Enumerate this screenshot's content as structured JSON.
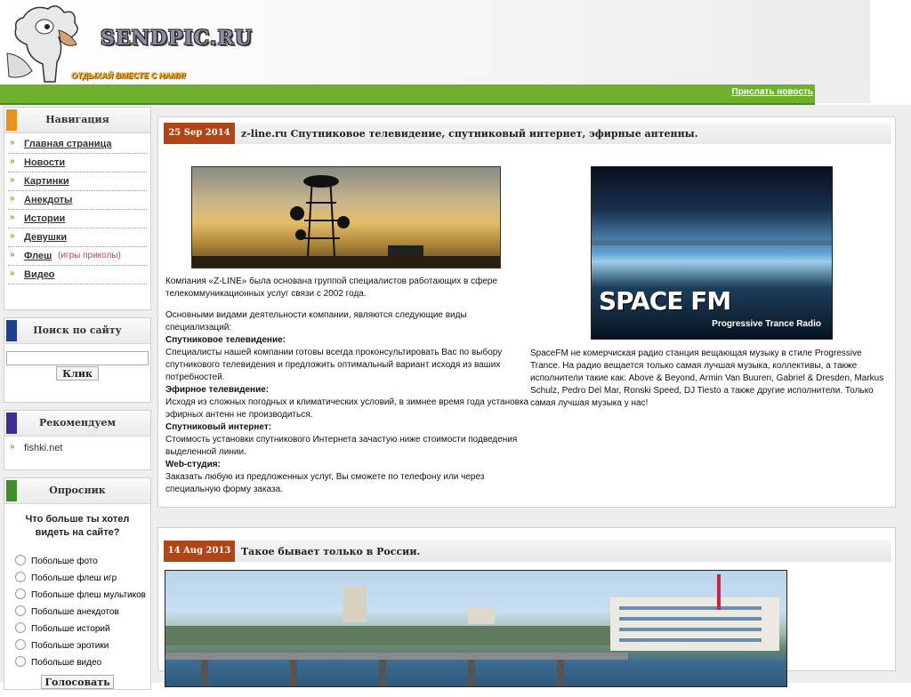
{
  "site": {
    "logo_text": "SENDPIC.RU",
    "slogan": "ОТДЫХАЙ ВМЕСТЕ С НАМИ!",
    "submit_news": "Прислать новость"
  },
  "sidebar": {
    "navigation": {
      "title": "Навигация",
      "items": [
        {
          "label": "Главная страница",
          "note": ""
        },
        {
          "label": "Новости",
          "note": ""
        },
        {
          "label": "Картинки",
          "note": ""
        },
        {
          "label": "Анекдоты",
          "note": ""
        },
        {
          "label": "Истории",
          "note": ""
        },
        {
          "label": "Девушки",
          "note": ""
        },
        {
          "label": "Флеш",
          "note": "(игры приколы)"
        },
        {
          "label": "Видео",
          "note": ""
        }
      ]
    },
    "search": {
      "title": "Поиск по сайту",
      "value": "",
      "button": "Клик"
    },
    "recommend": {
      "title": "Рекомендуем",
      "items": [
        "fishki.net"
      ]
    },
    "poll": {
      "title": "Опросник",
      "question": "Что больше ты хотел видеть на сайте?",
      "options": [
        "Побольше фото",
        "Побольше флеш игр",
        "Побольше флеш мультиков",
        "Побольше анекдотов",
        "Побольше историй",
        "Побольше эротики",
        "Побольше видео"
      ],
      "button": "Голосовать"
    },
    "colors": {
      "nav_stripe": "#e8911c",
      "search_stripe": "#1f3f8f",
      "recommend_stripe": "#3a2f91",
      "poll_stripe": "#3e8f2a"
    }
  },
  "posts": [
    {
      "date": "25 Sep 2014",
      "title": "z-line.ru Спутниковое телевидение, спутниковый интернет, эфирные антенны.",
      "left": {
        "intro": "Компания «Z-LINE» была основана группой специалистов работающих в сфере телекоммуникационных услуг связи с 2002 года.",
        "types_intro": "Основными видами деятельности компании, являются следующие виды специализаций:",
        "sections": [
          {
            "heading": "Спутниковое телевидение:",
            "text": "Специалисты нашей компании готовы всегда проконсультировать Вас по выбору спутникового телевидения и предложить оптимальный вариант исходя из ваших потребностей."
          },
          {
            "heading": "Эфирное телевидение:",
            "text": "Исходя из сложных погодных и климатических условий, в зимнее время года установка эфирных антенн не производиться."
          },
          {
            "heading": "Спутниковый интернет:",
            "text": "Стоимость установки спутникового Интернета зачастую ниже стоимости подведения выделенной линии."
          },
          {
            "heading": "Web-студия:",
            "text": "Заказать любую из предложенных услуг, Вы сможете по телефону или через специальную форму заказа."
          }
        ]
      },
      "right": {
        "image_title": "SPACE FM",
        "image_subtitle": "Progressive Trance Radio",
        "text": "SpaceFM не комерчиская радио станция вещающая музыку в стиле Progressive Trance. На радио вещается только самая лучшая музыка, коллективы, а также исполнители такие как: Above & Beyond, Armin Van Buuren, Gabriel & Dresden, Markus Schulz, Pedro Del Mar, Ronski Speed, DJ Tiesto а также другие исполнители. Только самая лучшая музыка у нас!"
      }
    },
    {
      "date": "14 Aug 2013",
      "title": "Такое бывает только в России."
    }
  ],
  "colors": {
    "green_bar": "#6db12e",
    "date_badge": "#b0451a",
    "page_bg": "#eeeeee"
  }
}
